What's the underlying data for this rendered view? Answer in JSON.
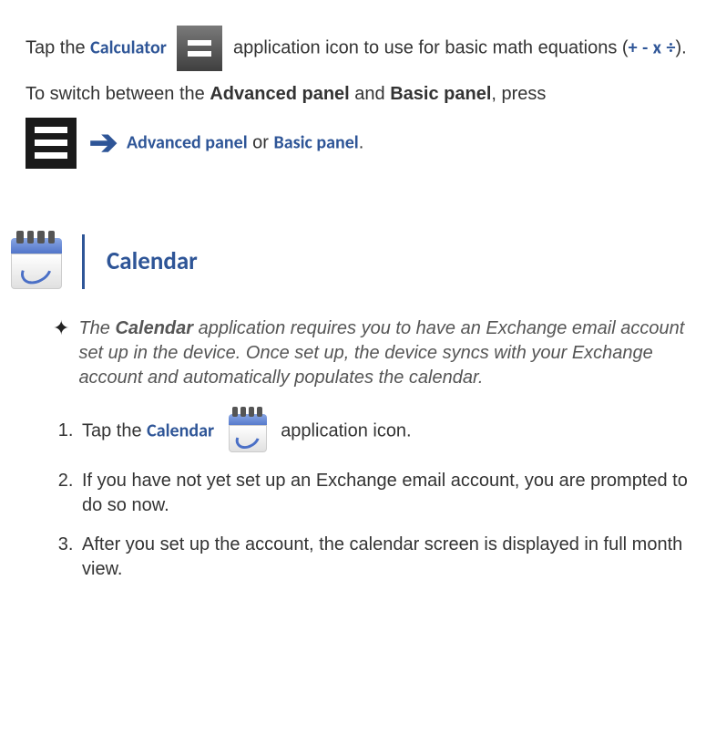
{
  "para1": {
    "t1": "Tap the ",
    "calc": "Calculator",
    "t2": " application icon to use for basic math equations (",
    "op_plus": "+",
    "sep": "   ",
    "op_minus": "-",
    "op_mult": "x",
    "op_div": "÷",
    "t3": ")."
  },
  "para2": {
    "t1": "To switch between the ",
    "adv": "Advanced panel",
    "and": " and ",
    "basic": "Basic panel",
    "t2": ", press"
  },
  "panelLine": {
    "adv": "Advanced panel",
    "or": " or ",
    "basic": "Basic panel",
    "dot": "."
  },
  "section": {
    "title": "Calendar"
  },
  "note": {
    "t1": "The ",
    "cal": "Calendar",
    "t2": " application requires you to have an Exchange email account set up in the device. Once set up, the device syncs with your Exchange account and automatically populates the calendar."
  },
  "steps": {
    "s1a": "Tap the ",
    "s1b": "Calendar",
    "s1c": " application icon.",
    "s2": "If you have not yet set up an Exchange email account, you are prompted to do so now.",
    "s3": "After you set up the account, the calendar screen is displayed in full month view."
  }
}
